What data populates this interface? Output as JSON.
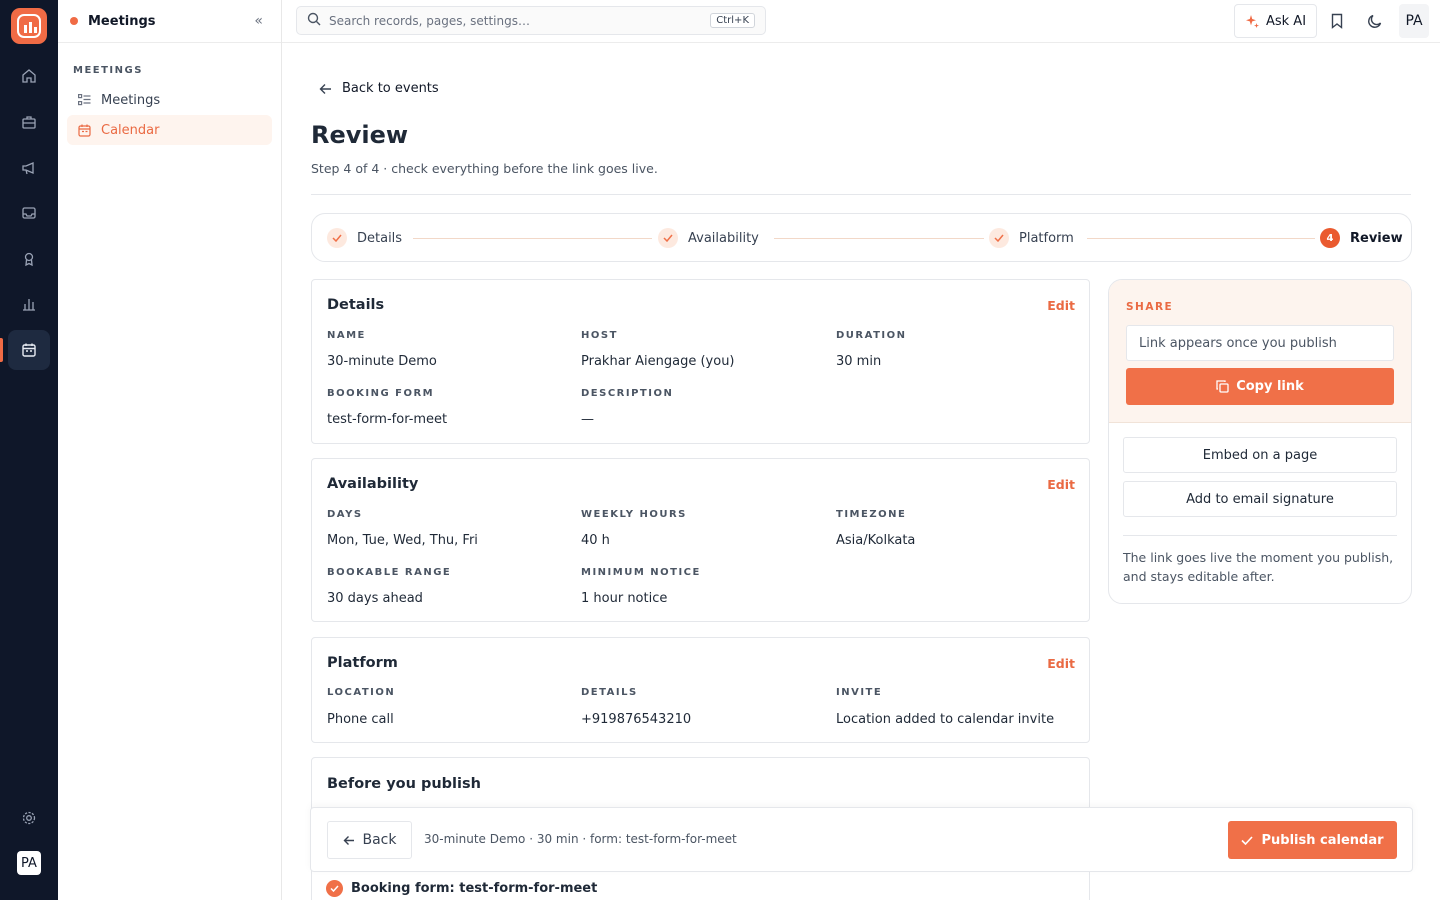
{
  "app": {
    "section_title": "Meetings",
    "collapse_glyph": "«",
    "accent": "#f06b45"
  },
  "rail": {
    "icons": [
      "home-icon",
      "briefcase-icon",
      "megaphone-icon",
      "inbox-icon",
      "award-icon",
      "chart-icon",
      "calendar-icon"
    ],
    "active": "calendar-icon",
    "bottom_icons": [
      "settings-icon"
    ],
    "avatar": "PA"
  },
  "sidebar": {
    "section_label": "MEETINGS",
    "items": [
      {
        "label": "Meetings",
        "icon": "list-icon",
        "active": false
      },
      {
        "label": "Calendar",
        "icon": "calendar-icon",
        "active": true
      }
    ]
  },
  "topbar": {
    "search_placeholder": "Search records, pages, settings…",
    "shortcut": "Ctrl+K",
    "ask_ai": "Ask AI",
    "avatar": "PA"
  },
  "page": {
    "back_label": "Back to events",
    "title": "Review",
    "subtitle": "Step 4 of 4 · check everything before the link goes live."
  },
  "stepper": {
    "steps": [
      {
        "label": "Details",
        "state": "done"
      },
      {
        "label": "Availability",
        "state": "done"
      },
      {
        "label": "Platform",
        "state": "done"
      },
      {
        "label": "Review",
        "state": "current",
        "number": "4"
      }
    ]
  },
  "details_card": {
    "title": "Details",
    "edit": "Edit",
    "fields": [
      {
        "label": "NAME",
        "value": "30-minute Demo"
      },
      {
        "label": "HOST",
        "value": "Prakhar Aiengage (you)"
      },
      {
        "label": "DURATION",
        "value": "30 min"
      },
      {
        "label": "BOOKING FORM",
        "value": "test-form-for-meet"
      },
      {
        "label": "DESCRIPTION",
        "value": "—"
      }
    ]
  },
  "availability_card": {
    "title": "Availability",
    "edit": "Edit",
    "fields": [
      {
        "label": "DAYS",
        "value": "Mon, Tue, Wed, Thu, Fri"
      },
      {
        "label": "WEEKLY HOURS",
        "value": "40 h"
      },
      {
        "label": "TIMEZONE",
        "value": "Asia/Kolkata"
      },
      {
        "label": "BOOKABLE RANGE",
        "value": "30 days ahead"
      },
      {
        "label": "MINIMUM NOTICE",
        "value": "1 hour notice"
      }
    ]
  },
  "platform_card": {
    "title": "Platform",
    "edit": "Edit",
    "fields": [
      {
        "label": "LOCATION",
        "value": "Phone call"
      },
      {
        "label": "DETAILS",
        "value": "+919876543210"
      },
      {
        "label": "INVITE",
        "value": "Location added to calendar invite"
      }
    ]
  },
  "publish_card": {
    "title": "Before you publish",
    "check_item": "Booking form: test-form-for-meet"
  },
  "share": {
    "label": "SHARE",
    "link_placeholder": "Link appears once you publish",
    "copy_label": "Copy link",
    "embed_label": "Embed on a page",
    "signature_label": "Add to email signature",
    "note": "The link goes live the moment you publish, and stays editable after."
  },
  "bottom_bar": {
    "back_label": "Back",
    "summary": "30-minute Demo · 30 min · form: test-form-for-meet",
    "publish_label": "Publish calendar"
  }
}
